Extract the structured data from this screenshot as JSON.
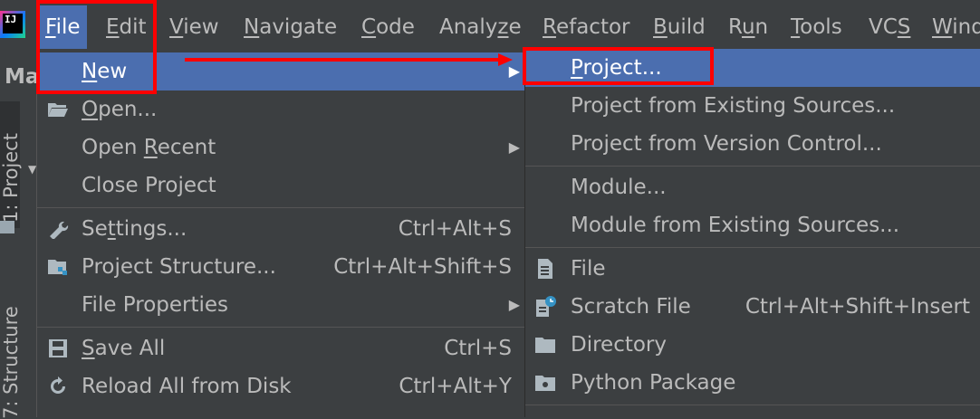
{
  "menubar": {
    "items": [
      {
        "label": "File",
        "mnemonic_index": 0,
        "active": true
      },
      {
        "label": "Edit",
        "mnemonic_index": 0,
        "active": false
      },
      {
        "label": "View",
        "mnemonic_index": 0,
        "active": false
      },
      {
        "label": "Navigate",
        "mnemonic_index": 0,
        "active": false
      },
      {
        "label": "Code",
        "mnemonic_index": 0,
        "active": false
      },
      {
        "label": "Analyze",
        "mnemonic_index": 5,
        "active": false
      },
      {
        "label": "Refactor",
        "mnemonic_index": 0,
        "active": false
      },
      {
        "label": "Build",
        "mnemonic_index": 0,
        "active": false
      },
      {
        "label": "Run",
        "mnemonic_index": 1,
        "active": false
      },
      {
        "label": "Tools",
        "mnemonic_index": 0,
        "active": false
      },
      {
        "label": "VCS",
        "mnemonic_index": 2,
        "active": false
      },
      {
        "label": "Wind",
        "mnemonic_index": 0,
        "active": false
      }
    ]
  },
  "left_strip": {
    "breadcrumb": "Ma",
    "project_tab": "1: Project",
    "structure_tab": "7: Structure"
  },
  "file_menu": {
    "items": [
      {
        "label": "New",
        "mnemonic_index": 0,
        "icon": "",
        "shortcut": "",
        "submenu": true,
        "highlight": true
      },
      {
        "label": "Open...",
        "mnemonic_index": 0,
        "icon": "folder-open-icon",
        "shortcut": "",
        "submenu": false
      },
      {
        "label": "Open Recent",
        "mnemonic_index": 5,
        "icon": "",
        "shortcut": "",
        "submenu": true
      },
      {
        "label": "Close Project",
        "mnemonic_index": -1,
        "icon": "",
        "shortcut": "",
        "submenu": false
      },
      {
        "label": "Settings...",
        "mnemonic_index": 2,
        "icon": "wrench-icon",
        "shortcut": "Ctrl+Alt+S",
        "submenu": false
      },
      {
        "label": "Project Structure...",
        "mnemonic_index": -1,
        "icon": "project-structure-icon",
        "shortcut": "Ctrl+Alt+Shift+S",
        "submenu": false
      },
      {
        "label": "File Properties",
        "mnemonic_index": -1,
        "icon": "",
        "shortcut": "",
        "submenu": true
      },
      {
        "label": "Save All",
        "mnemonic_index": 0,
        "icon": "save-icon",
        "shortcut": "Ctrl+S",
        "submenu": false
      },
      {
        "label": "Reload All from Disk",
        "mnemonic_index": -1,
        "icon": "reload-icon",
        "shortcut": "Ctrl+Alt+Y",
        "submenu": false
      }
    ]
  },
  "new_submenu": {
    "items": [
      {
        "label": "Project...",
        "mnemonic_index": 0,
        "icon": "",
        "shortcut": "",
        "highlight": true
      },
      {
        "label": "Project from Existing Sources...",
        "mnemonic_index": -1,
        "icon": "",
        "shortcut": ""
      },
      {
        "label": "Project from Version Control...",
        "mnemonic_index": -1,
        "icon": "",
        "shortcut": ""
      },
      {
        "label": "Module...",
        "mnemonic_index": -1,
        "icon": "",
        "shortcut": ""
      },
      {
        "label": "Module from Existing Sources...",
        "mnemonic_index": -1,
        "icon": "",
        "shortcut": ""
      },
      {
        "label": "File",
        "mnemonic_index": -1,
        "icon": "file-icon",
        "shortcut": ""
      },
      {
        "label": "Scratch File",
        "mnemonic_index": -1,
        "icon": "scratch-file-icon",
        "shortcut": "Ctrl+Alt+Shift+Insert"
      },
      {
        "label": "Directory",
        "mnemonic_index": -1,
        "icon": "directory-icon",
        "shortcut": ""
      },
      {
        "label": "Python Package",
        "mnemonic_index": -1,
        "icon": "python-package-icon",
        "shortcut": ""
      }
    ]
  },
  "colors": {
    "background": "#3c3f41",
    "highlight": "#4b6eaf",
    "text": "#bbbbbb",
    "annotation": "#ff0000"
  }
}
